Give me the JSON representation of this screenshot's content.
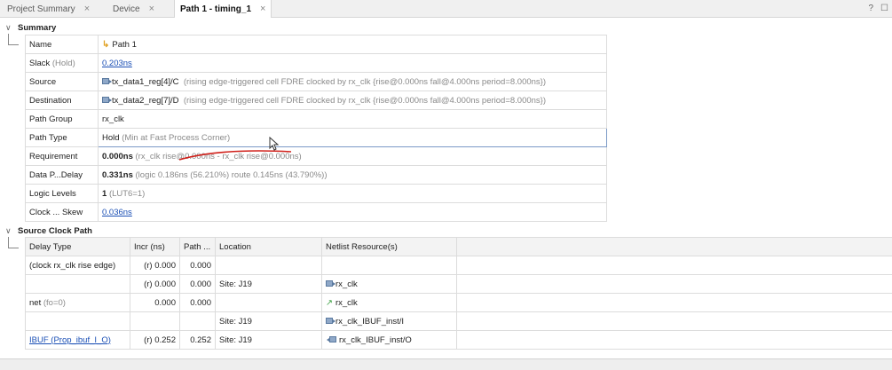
{
  "tabs": [
    {
      "label": "Project Summary",
      "close": "×"
    },
    {
      "label": "Device",
      "close": "×"
    },
    {
      "label": "Path 1 - timing_1",
      "close": "×"
    }
  ],
  "window_controls": {
    "help": "?",
    "restore": "☐"
  },
  "summary": {
    "section_label": "Summary",
    "rows": {
      "name": {
        "key": "Name",
        "value": "Path 1"
      },
      "slack": {
        "key": "Slack",
        "key_suffix": "(Hold)",
        "value": "0.203ns"
      },
      "source": {
        "key": "Source",
        "value": "tx_data1_reg[4]/C",
        "detail": "(rising edge-triggered cell FDRE clocked by rx_clk {rise@0.000ns fall@4.000ns period=8.000ns})"
      },
      "destination": {
        "key": "Destination",
        "value": "tx_data2_reg[7]/D",
        "detail": "(rising edge-triggered cell FDRE clocked by rx_clk {rise@0.000ns fall@4.000ns period=8.000ns})"
      },
      "path_group": {
        "key": "Path Group",
        "value": "rx_clk"
      },
      "path_type": {
        "key": "Path Type",
        "value": "Hold",
        "detail": "(Min at Fast Process Corner)"
      },
      "requirement": {
        "key": "Requirement",
        "value": "0.000ns",
        "detail": "(rx_clk rise@0.000ns - rx_clk rise@0.000ns)"
      },
      "data_path_delay": {
        "key": "Data P...Delay",
        "value": "0.331ns",
        "detail": "(logic 0.186ns (56.210%)  route 0.145ns (43.790%))"
      },
      "logic_levels": {
        "key": "Logic Levels",
        "value": "1",
        "detail": "(LUT6=1)"
      },
      "clock_skew": {
        "key": "Clock ... Skew",
        "value": "0.036ns"
      }
    }
  },
  "source_clock_path": {
    "section_label": "Source Clock Path",
    "columns": [
      "Delay Type",
      "Incr (ns)",
      "Path ...",
      "Location",
      "Netlist Resource(s)"
    ],
    "rows": [
      {
        "delay_type": "(clock rx_clk rise edge)",
        "delay_type_muted": "",
        "incr": "(r) 0.000",
        "path": "0.000",
        "location": "",
        "resource": "",
        "resource_icon": ""
      },
      {
        "delay_type": "",
        "delay_type_muted": "",
        "incr": "(r) 0.000",
        "path": "0.000",
        "location": "Site: J19",
        "resource": "rx_clk",
        "resource_icon": "port-in-icon"
      },
      {
        "delay_type": "net",
        "delay_type_muted": "(fo=0)",
        "incr": "0.000",
        "path": "0.000",
        "location": "",
        "resource": "rx_clk",
        "resource_icon": "net-icon"
      },
      {
        "delay_type": "",
        "delay_type_muted": "",
        "incr": "",
        "path": "",
        "location": "Site: J19",
        "resource": "rx_clk_IBUF_inst/I",
        "resource_icon": "pin-in-icon"
      },
      {
        "delay_type": "IBUF (Prop_ibuf_I_O)",
        "delay_type_muted": "",
        "incr": "(r) 0.252",
        "path": "0.252",
        "location": "Site: J19",
        "resource": "rx_clk_IBUF_inst/O",
        "resource_icon": "pin-out-icon"
      }
    ]
  }
}
